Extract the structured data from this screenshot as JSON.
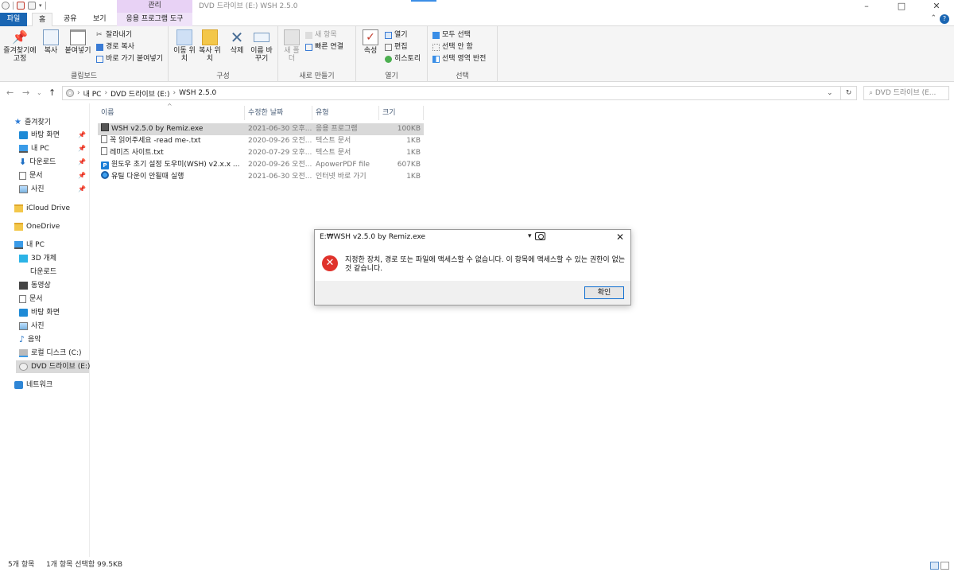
{
  "window": {
    "title": "DVD 드라이브 (E:) WSH 2.5.0",
    "manage_tab": "관리",
    "controls": [
      "–",
      "□",
      "✕"
    ]
  },
  "ribbon_tabs": [
    "파일",
    "홈",
    "공유",
    "보기",
    "응용 프로그램 도구"
  ],
  "ribbon": {
    "clipboard": {
      "label": "클립보드",
      "pin": "즐겨찾기에 고정",
      "copy": "복사",
      "paste": "붙여넣기",
      "cut": "잘라내기",
      "copy_path": "경로 복사",
      "paste_shortcut": "바로 가기 붙여넣기"
    },
    "organize": {
      "label": "구성",
      "move_to": "이동 위치",
      "copy_to": "복사 위치",
      "delete": "삭제",
      "rename": "이름 바꾸기"
    },
    "new": {
      "label": "새로 만들기",
      "new_folder": "새 폴더",
      "new_item": "새 항목",
      "easy_access": "빠른 연결"
    },
    "open": {
      "label": "열기",
      "properties": "속성",
      "open": "열기",
      "edit": "편집",
      "history": "히스토리"
    },
    "select": {
      "label": "선택",
      "select_all": "모두 선택",
      "select_none": "선택 안 함",
      "invert": "선택 영역 반전"
    }
  },
  "address": {
    "crumbs": [
      "내 PC",
      "DVD 드라이브 (E:)",
      "WSH 2.5.0"
    ],
    "search_placeholder": "DVD 드라이브 (E..."
  },
  "nav": {
    "quick_access": "즐겨찾기",
    "quick_items": [
      "바탕 화면",
      "내 PC",
      "다운로드",
      "문서",
      "사진"
    ],
    "icloud": "iCloud Drive",
    "onedrive": "OneDrive",
    "this_pc": "내 PC",
    "pc_items": [
      "3D 개체",
      "다운로드",
      "동영상",
      "문서",
      "바탕 화면",
      "사진",
      "음악",
      "로컬 디스크 (C:)",
      "DVD 드라이브 (E:)"
    ],
    "network": "네트워크"
  },
  "columns": {
    "name": "이름",
    "date": "수정한 날짜",
    "type": "유형",
    "size": "크기"
  },
  "files": [
    {
      "name": "WSH v2.5.0 by Remiz.exe",
      "date": "2021-06-30 오후...",
      "type": "응용 프로그램",
      "size": "100KB",
      "icon": "exe-icon"
    },
    {
      "name": "꼭 읽어주세요 -read me-.txt",
      "date": "2020-09-26 오전...",
      "type": "텍스트 문서",
      "size": "1KB",
      "icon": "text-file-icon"
    },
    {
      "name": "레미즈 사이트.txt",
      "date": "2020-07-29 오후...",
      "type": "텍스트 문서",
      "size": "1KB",
      "icon": "text-file-icon"
    },
    {
      "name": "윈도우 초기 설정 도우미(WSH) v2.x.x ...",
      "date": "2020-09-26 오전...",
      "type": "ApowerPDF file",
      "size": "607KB",
      "icon": "pdf-file-icon"
    },
    {
      "name": "유틸 다운이 안될때 실행",
      "date": "2021-06-30 오전...",
      "type": "인터넷 바로 가기",
      "size": "1KB",
      "icon": "url-shortcut-icon"
    }
  ],
  "dialog": {
    "title": "E:₩WSH v2.5.0 by Remiz.exe",
    "message": "지정한 장치, 경로 또는 파일에 액세스할 수 없습니다. 이 항목에 액세스할 수 있는 권한이 없는 것 같습니다.",
    "ok": "확인"
  },
  "status": {
    "count": "5개 항목",
    "selection": "1개 항목 선택함 99.5KB"
  },
  "colors": {
    "accent": "#1a66b3",
    "app_tools_tab": "#e8d2f5",
    "error": "#e0322b"
  }
}
